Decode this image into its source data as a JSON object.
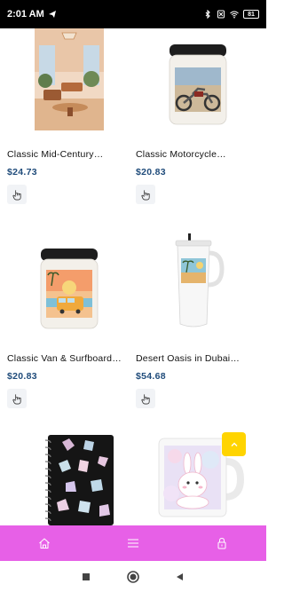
{
  "status_bar": {
    "time": "2:01 AM",
    "battery": "81",
    "icons": [
      "telegram-icon",
      "bluetooth-icon",
      "no-sim-icon",
      "wifi-icon",
      "battery-icon"
    ]
  },
  "products": [
    {
      "title": "Classic Mid-Century…",
      "price": "$24.73",
      "image": "mid-century-room-poster"
    },
    {
      "title": "Classic Motorcycle…",
      "price": "$20.83",
      "image": "motorcycle-candle-jar"
    },
    {
      "title": "Classic Van & Surfboard…",
      "price": "$20.83",
      "image": "van-surfboard-candle-jar"
    },
    {
      "title": "Desert Oasis in Dubai…",
      "price": "$54.68",
      "image": "desert-oasis-tumbler"
    },
    {
      "title": "",
      "price": "",
      "image": "gemstone-spiral-notebook"
    },
    {
      "title": "",
      "price": "",
      "image": "bunny-mug"
    }
  ],
  "icons": {
    "tap": "hand-pointer-icon",
    "scroll_top": "chevron-up-icon",
    "nav": [
      "home-icon",
      "menu-icon",
      "lock-icon"
    ],
    "system": [
      "recents-square-icon",
      "home-circle-icon",
      "back-triangle-icon"
    ]
  },
  "colors": {
    "bottom_nav": "#e760e7",
    "price": "#1f4b7a",
    "scroll_top": "#ffd400"
  }
}
